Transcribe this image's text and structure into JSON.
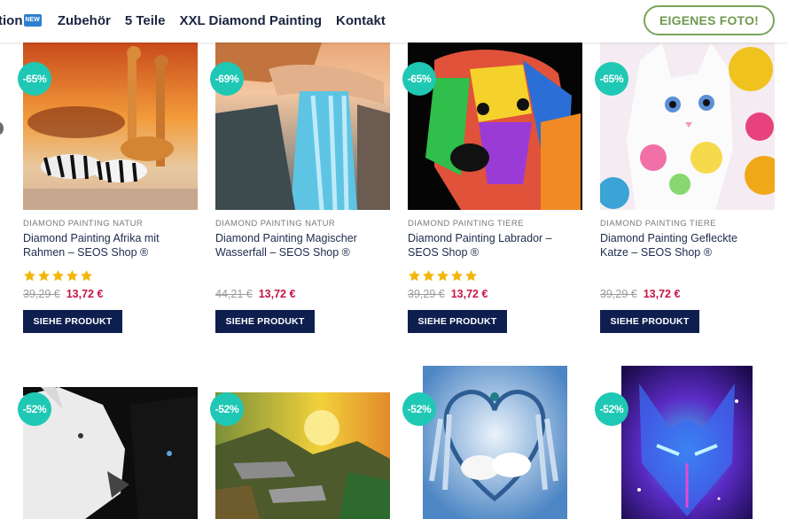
{
  "nav": {
    "items": [
      {
        "label": "tion",
        "badge": "NEW"
      },
      {
        "label": "Zubehör"
      },
      {
        "label": "5 Teile"
      },
      {
        "label": "XXL Diamond Painting"
      },
      {
        "label": "Kontakt"
      }
    ],
    "cta_label": "EIGENES FOTO!"
  },
  "products": [
    {
      "sale": "-65%",
      "category": "DIAMOND PAINTING NATUR",
      "title": "Diamond Painting Afrika mit Rahmen – SEOS Shop ®",
      "stars": 5,
      "old_price": "39,29 €",
      "new_price": "13,72 €",
      "button": "SIEHE PRODUKT",
      "image": "giraffe-zebra-icon"
    },
    {
      "sale": "-69%",
      "category": "DIAMOND PAINTING NATUR",
      "title": "Diamond Painting Magischer Wasserfall – SEOS Shop ®",
      "stars": 0,
      "old_price": "44,21 €",
      "new_price": "13,72 €",
      "button": "SIEHE PRODUKT",
      "image": "waterfall-icon"
    },
    {
      "sale": "-65%",
      "category": "DIAMOND PAINTING TIERE",
      "title": "Diamond Painting Labrador – SEOS Shop ®",
      "stars": 5,
      "old_price": "39,29 €",
      "new_price": "13,72 €",
      "button": "SIEHE PRODUKT",
      "image": "dog-icon"
    },
    {
      "sale": "-65%",
      "category": "DIAMOND PAINTING TIERE",
      "title": "Diamond Painting Gefleckte Katze – SEOS Shop ®",
      "stars": 0,
      "old_price": "39,29 €",
      "new_price": "13,72 €",
      "button": "SIEHE PRODUKT",
      "image": "cat-icon"
    }
  ],
  "row2": [
    {
      "sale": "-52%",
      "image": "white-wolf-icon"
    },
    {
      "sale": "-52%",
      "image": "wolf-pack-icon"
    },
    {
      "sale": "-52%",
      "image": "dreamcatcher-wolves-icon"
    },
    {
      "sale": "-52%",
      "image": "galaxy-wolf-icon"
    }
  ],
  "colors": {
    "sale_badge": "#1fc8b4",
    "button": "#0e1f4f",
    "new_price": "#c81446",
    "cta": "#7aa55a",
    "stars": "#f2b705"
  }
}
